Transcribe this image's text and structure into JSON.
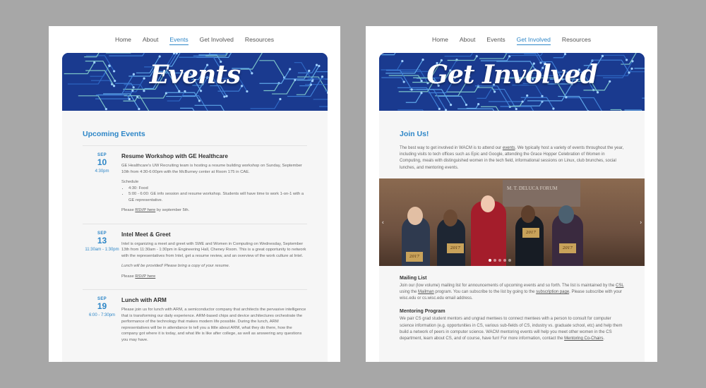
{
  "left_page": {
    "nav": [
      "Home",
      "About",
      "Events",
      "Get Involved",
      "Resources"
    ],
    "active_nav": "Events",
    "banner_title": "Events",
    "section_title": "Upcoming Events",
    "events": [
      {
        "month": "SEP",
        "day": "10",
        "time": "4:30pm",
        "title": "Resume Workshop with GE Healthcare",
        "desc": "GE Healthcare's UW Recruiting team is hosting a resume building workshop on Sunday, September 10th from 4:30-6:00pm with the McBurney center at Room 175 in CAE.",
        "schedule_label": "Schedule",
        "schedule": [
          "4:30: Food",
          "5:00 - 6:00: GE info session and resume workshop. Students will have time to work 1-on-1 with a GE representative."
        ],
        "rsvp_prefix": "Please ",
        "rsvp_link": "RSVP here",
        "rsvp_suffix": " by september 5th."
      },
      {
        "month": "SEP",
        "day": "13",
        "time": "11:30am - 1:30pm",
        "title": "Intel Meet & Greet",
        "desc": "Intel is organizing a meet and greet with SWE and Women in Computing on Wednesday, September 13th from 11:30am - 1:30pm in Engineering Hall, Cheney Room. This is a great opportunity to network with the representatives from Intel, get a resume review, and an overview of the work culture at Intel.",
        "note": "Lunch will be provided! Please bring a copy of your resume.",
        "rsvp_prefix": "Please ",
        "rsvp_link": "RSVP here",
        "rsvp_suffix": ""
      },
      {
        "month": "SEP",
        "day": "19",
        "time": "6:00 - 7:30pm",
        "title": "Lunch with ARM",
        "desc": "Please join us for lunch with ARM, a semiconductor company that architects the pervasive intelligence that is transforming our daily experience. ARM-based chips and device architectures orchestrate the performance of the technology that makes modern life possible. During the lunch, ARM representatives will be in attendance to tell you a little about ARM, what they do there, how the company got where it is today, and what life is like after college, as well as answering any questions you may have."
      }
    ]
  },
  "right_page": {
    "nav": [
      "Home",
      "About",
      "Events",
      "Get Involved",
      "Resources"
    ],
    "active_nav": "Get Involved",
    "banner_title": "Get Involved",
    "section_title": "Join Us!",
    "intro_a": "The best way to get involved in WACM is to attend our ",
    "intro_link": "events",
    "intro_b": ". We typically host a variety of events throughout the year, including visits to tech offices such as Epic and Google, attending the Grace Hopper Celebration of Women in Computing, meals with distinguished women in the tech field, informational sessions on Linux, club brunches, social lunches, and mentoring events.",
    "photo": {
      "sign_text": "M. T. DELUCA FORUM",
      "placards": [
        "2017",
        "2017",
        "2017",
        "2017"
      ]
    },
    "mailing": {
      "heading": "Mailing List",
      "text_a": "Join our (low volume) mailing list for announcements of upcoming events and so forth. The list is maintained by the ",
      "link1": "CSL",
      "text_b": " using the ",
      "link2": "Mailman",
      "text_c": " program. You can subscribe to the list by going to the ",
      "link3": "subscription page",
      "text_d": ". Please subscribe with your wisc.edu or cs.wisc.edu email address."
    },
    "mentoring": {
      "heading": "Mentoring Program",
      "text_a": "We pair CS grad student mentors and ungrad mentees to connect mentees with a person to consult for computer science information (e.g. opportunities in CS, various sub-fields of CS, industry vs. graduate school, etc) and help them build a network of peers in computer science. WACM mentoring events will help you meet other women in the CS department, learn about CS, and of course, have fun! For more information, contact the ",
      "link": "Mentoring Co-Chairs",
      "text_b": "."
    }
  },
  "colors": {
    "accent": "#2d86c7",
    "banner": "#1a3a8f",
    "background": "#a7a7a7"
  }
}
